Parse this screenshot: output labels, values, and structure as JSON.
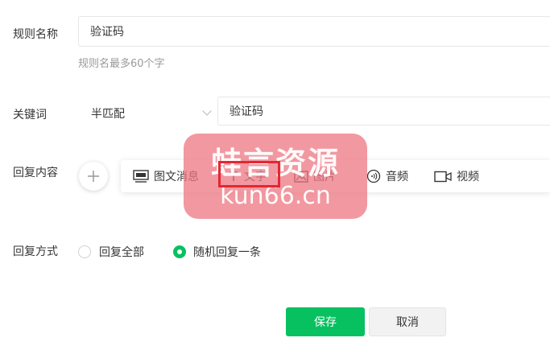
{
  "form": {
    "rule_name": {
      "label": "规则名称",
      "value": "验证码",
      "hint": "规则名最多60个字"
    },
    "keyword": {
      "label": "关键词",
      "match_mode": "半匹配",
      "value": "验证码"
    },
    "reply_content": {
      "label": "回复内容",
      "tools": [
        {
          "icon": "image-text-icon",
          "label": "图文消息"
        },
        {
          "icon": "text-icon",
          "label": "文字"
        },
        {
          "icon": "image-icon",
          "label": "图片"
        },
        {
          "icon": "audio-icon",
          "label": "音频"
        },
        {
          "icon": "video-icon",
          "label": "视频"
        }
      ]
    },
    "reply_mode": {
      "label": "回复方式",
      "options": [
        {
          "label": "回复全部",
          "selected": false
        },
        {
          "label": "随机回复一条",
          "selected": true
        }
      ]
    }
  },
  "actions": {
    "save": "保存",
    "cancel": "取消"
  },
  "watermark": {
    "line1": "蛙言资源",
    "line2": "kun66.cn"
  },
  "colors": {
    "accent": "#07c160",
    "highlight": "#e32732",
    "watermark": "#ee7682"
  }
}
